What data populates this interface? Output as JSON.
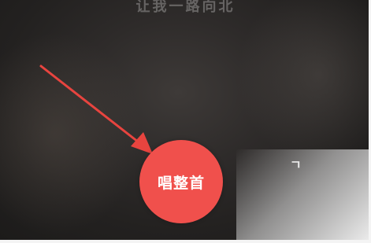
{
  "lyric_line": "让我一路向北",
  "partial_text": "ㄱ",
  "sing_button": {
    "label": "唱整首",
    "color": "#f0504c"
  },
  "annotation_arrow": {
    "color": "#e8443f",
    "icon": "arrow-annotation-icon"
  }
}
